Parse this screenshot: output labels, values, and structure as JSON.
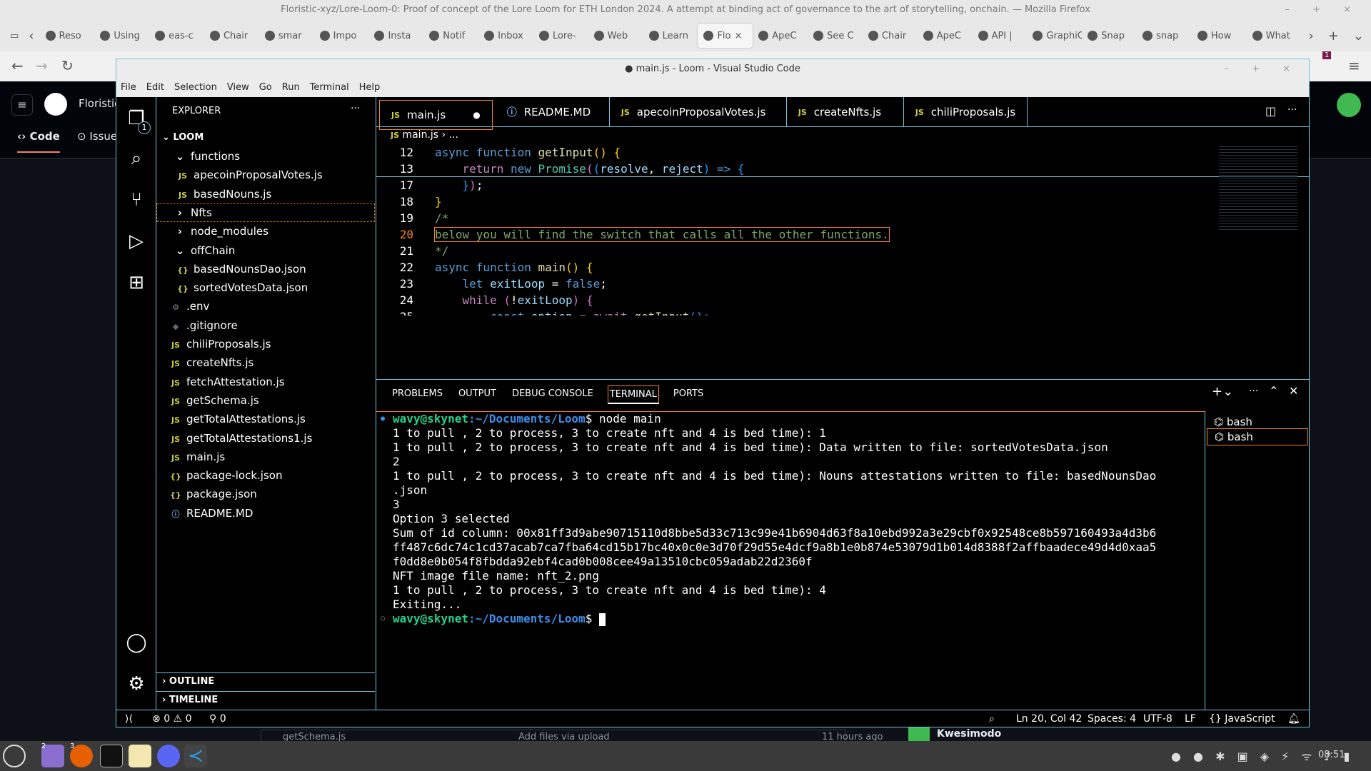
{
  "firefox": {
    "title": "Floristic-xyz/Lore-Loom-0: Proof of concept of the Lore Loom for ETH London 2024. A attempt at binding act of governance to the art of storytelling, onchain. — Mozilla Firefox",
    "tabs": [
      "Reso",
      "Using",
      "eas-c",
      "Chair",
      "smar",
      "Impo",
      "Insta",
      "Notif",
      "Inbox",
      "Lore-",
      "Web",
      "Learn",
      "Flo",
      "ApeC",
      "See C",
      "Chair",
      "ApeC",
      "API |",
      "GraphiQ",
      "Snap",
      "snap",
      "How",
      "What"
    ],
    "active_tab": 12,
    "extension_badge": "1"
  },
  "github": {
    "repo": "Floristic",
    "tabs": [
      "Code",
      "Issue"
    ],
    "file_row": {
      "name": "getSchema.js",
      "message": "Add files via upload",
      "time": "11 hours ago"
    },
    "user": "Kwesimodo"
  },
  "vscode": {
    "title": "● main.js - Loom - Visual Studio Code",
    "menu": [
      "File",
      "Edit",
      "Selection",
      "View",
      "Go",
      "Run",
      "Terminal",
      "Help"
    ],
    "explorer_badge": "1",
    "sidebar": {
      "title": "EXPLORER",
      "more": "···",
      "root": "LOOM",
      "tree": [
        {
          "label": "functions",
          "type": "folder-open",
          "depth": 1
        },
        {
          "label": "apecoinProposalVotes.js",
          "type": "js",
          "depth": 2
        },
        {
          "label": "basedNouns.js",
          "type": "js",
          "depth": 2
        },
        {
          "label": "Nfts",
          "type": "folder",
          "depth": 1,
          "focus": true
        },
        {
          "label": "node_modules",
          "type": "folder",
          "depth": 1
        },
        {
          "label": "offChain",
          "type": "folder-open",
          "depth": 1
        },
        {
          "label": "basedNounsDao.json",
          "type": "json",
          "depth": 2
        },
        {
          "label": "sortedVotesData.json",
          "type": "json",
          "depth": 2
        },
        {
          "label": ".env",
          "type": "env",
          "depth": 1
        },
        {
          "label": ".gitignore",
          "type": "git",
          "depth": 1
        },
        {
          "label": "chiliProposals.js",
          "type": "js",
          "depth": 1
        },
        {
          "label": "createNfts.js",
          "type": "js",
          "depth": 1
        },
        {
          "label": "fetchAttestation.js",
          "type": "js",
          "depth": 1
        },
        {
          "label": "getSchema.js",
          "type": "js",
          "depth": 1
        },
        {
          "label": "getTotalAttestations.js",
          "type": "js",
          "depth": 1
        },
        {
          "label": "getTotalAttestations1.js",
          "type": "js",
          "depth": 1
        },
        {
          "label": "main.js",
          "type": "js",
          "depth": 1
        },
        {
          "label": "package-lock.json",
          "type": "json",
          "depth": 1
        },
        {
          "label": "package.json",
          "type": "json",
          "depth": 1
        },
        {
          "label": "README.MD",
          "type": "info",
          "depth": 1
        }
      ],
      "outline": "OUTLINE",
      "timeline": "TIMELINE"
    },
    "tabs": [
      {
        "label": "main.js",
        "icon": "JS",
        "active": true,
        "dirty": true
      },
      {
        "label": "README.MD",
        "icon": "ⓘ"
      },
      {
        "label": "apecoinProposalVotes.js",
        "icon": "JS"
      },
      {
        "label": "createNfts.js",
        "icon": "JS"
      },
      {
        "label": "chiliProposals.js",
        "icon": "JS"
      }
    ],
    "breadcrumb": [
      "main.js",
      "..."
    ],
    "code": [
      {
        "n": "12",
        "t": [
          [
            "async ",
            "kw"
          ],
          [
            "function ",
            "kw"
          ],
          [
            "getInput",
            "fn"
          ],
          [
            "()",
            "p1"
          ],
          [
            " {",
            "p1"
          ]
        ]
      },
      {
        "n": "13",
        "t": [
          [
            "    return ",
            "ctl"
          ],
          [
            "new ",
            "kw"
          ],
          [
            "Promise",
            "cls"
          ],
          [
            "(",
            "p2"
          ],
          [
            "(",
            "p3"
          ],
          [
            "resolve",
            "var"
          ],
          [
            ", ",
            "tx"
          ],
          [
            "reject",
            "var"
          ],
          [
            ")",
            "p3"
          ],
          [
            " => ",
            "kw"
          ],
          [
            "{",
            "p3"
          ]
        ]
      },
      {
        "n": "17",
        "t": [
          [
            "    }",
            "p3"
          ],
          [
            ")",
            "p2"
          ],
          [
            ";",
            "tx"
          ]
        ]
      },
      {
        "n": "18",
        "t": [
          [
            "}",
            "p1"
          ]
        ]
      },
      {
        "n": "19",
        "t": [
          [
            "/*",
            "cm"
          ]
        ]
      },
      {
        "n": "20",
        "t": [
          [
            "below you will find the switch that calls all the other functions.",
            "cm"
          ]
        ],
        "current": true
      },
      {
        "n": "21",
        "t": [
          [
            "*/",
            "cm"
          ]
        ]
      },
      {
        "n": "22",
        "t": [
          [
            "async ",
            "kw"
          ],
          [
            "function ",
            "kw"
          ],
          [
            "main",
            "fn"
          ],
          [
            "()",
            "p1"
          ],
          [
            " {",
            "p1"
          ]
        ]
      },
      {
        "n": "23",
        "t": [
          [
            "    let ",
            "kw"
          ],
          [
            "exitLoop",
            "var"
          ],
          [
            " = ",
            "tx"
          ],
          [
            "false",
            "kw"
          ],
          [
            ";",
            "tx"
          ]
        ]
      },
      {
        "n": "24",
        "t": [
          [
            "    while ",
            "ctl"
          ],
          [
            "(",
            "p2"
          ],
          [
            "!",
            "tx"
          ],
          [
            "exitLoop",
            "var"
          ],
          [
            ")",
            "p2"
          ],
          [
            " {",
            "p2"
          ]
        ]
      },
      {
        "n": "25",
        "t": [
          [
            "        const ",
            "kw"
          ],
          [
            "option",
            "var"
          ],
          [
            " = ",
            "tx"
          ],
          [
            "await ",
            "ctl"
          ],
          [
            "getInput",
            "fn"
          ],
          [
            "();",
            "p3"
          ]
        ]
      }
    ],
    "panel_tabs": [
      "PROBLEMS",
      "OUTPUT",
      "DEBUG CONSOLE",
      "TERMINAL",
      "PORTS"
    ],
    "active_panel_tab": 3,
    "terminal": {
      "prompt_user": "wavy@skynet",
      "prompt_path": ":~/Documents/Loom",
      "prompt_sign": "$ ",
      "command": "node main",
      "output": [
        "1 to pull , 2 to process, 3 to create nft and 4 is bed time): 1",
        "1 to pull , 2 to process, 3 to create nft and 4 is bed time): Data written to file: sortedVotesData.json",
        "2",
        "1 to pull , 2 to process, 3 to create nft and 4 is bed time): Nouns attestations written to file: basedNounsDao",
        ".json",
        "3",
        "Option 3 selected",
        "Sum of id column: 00x81ff3d9abe90715110d8bbe5d33c713c99e41b6904d63f8a10ebd992a3e29cbf0x92548ce8b597160493a4d3b6",
        "ff487c6dc74c1cd37acab7ca7fba64cd15b17bc40x0c0e3d70f29d55e4dcf9a8b1e0b874e53079d1b014d8388f2affbaadece49d4d0xaa5",
        "f0dd8e0b054f8fbdda92ebf4cad0b008cee49a13510cbc059adab22d2360f",
        "NFT image file name: nft_2.png",
        "1 to pull , 2 to process, 3 to create nft and 4 is bed time): 4",
        "Exiting..."
      ],
      "sessions": [
        "bash",
        "bash"
      ]
    },
    "status": {
      "errors": "0",
      "warnings": "0",
      "ports": "0",
      "position": "Ln 20, Col 42",
      "spaces": "Spaces: 4",
      "encoding": "UTF-8",
      "eol": "LF",
      "language": "JavaScript"
    }
  },
  "taskbar": {
    "clock": "08:51",
    "badge_files": "2",
    "badge_firefox": "3"
  },
  "colors": {
    "accent": "#f38518",
    "border": "#6fc3df",
    "prompt_user": "#23d18b",
    "prompt_path": "#3b8eea"
  }
}
